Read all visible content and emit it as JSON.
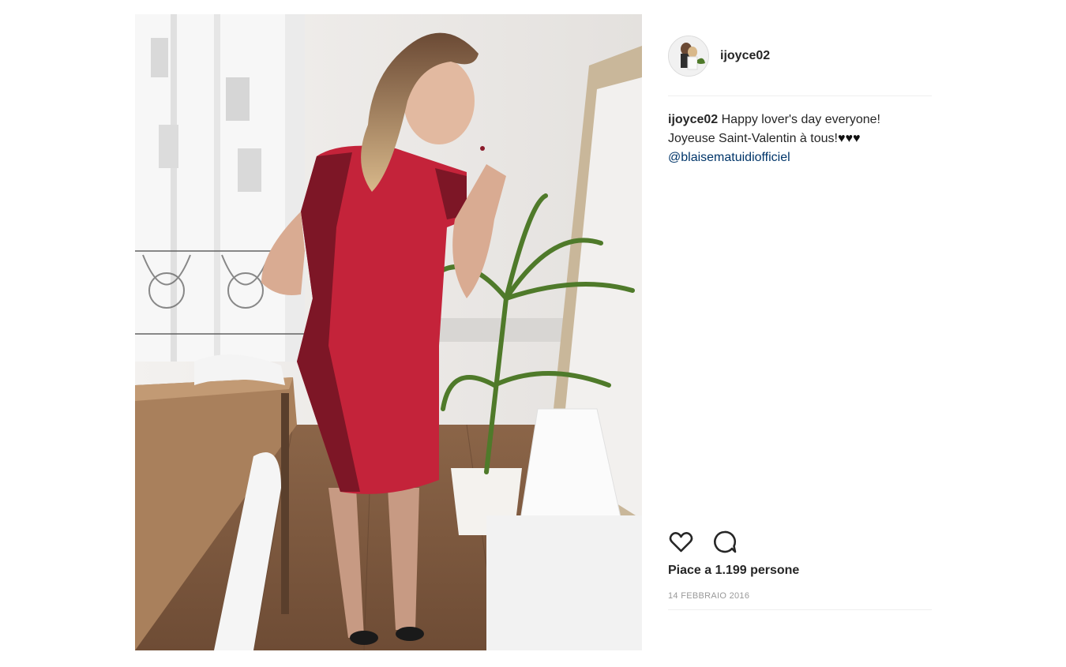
{
  "post": {
    "username": "ijoyce02",
    "caption": {
      "author": "ijoyce02",
      "line1": "Happy lover's day everyone!",
      "line2": "Joyeuse Saint-Valentin à tous!",
      "hearts": "♥♥♥",
      "mention": "@blaisematuidiofficiel"
    },
    "likes_text": "Piace a 1.199 persone",
    "date": "14 FEBBRAIO 2016"
  },
  "icons": {
    "like": "heart-outline-icon",
    "comment": "speech-bubble-icon"
  },
  "colors": {
    "text": "#262626",
    "link": "#003569",
    "muted": "#999999",
    "divider": "#efefef"
  }
}
